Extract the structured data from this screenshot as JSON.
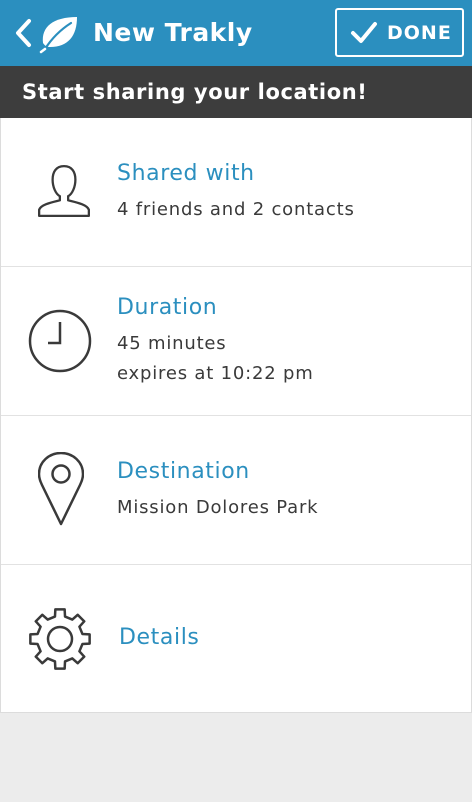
{
  "header": {
    "title": "New Trakly",
    "done_label": "DONE",
    "back_icon": "chevron-left-icon",
    "logo_icon": "leaf-icon",
    "check_icon": "checkmark-icon"
  },
  "banner": {
    "text": "Start sharing your location!"
  },
  "rows": [
    {
      "icon": "person-icon",
      "title": "Shared with",
      "subtitle": "4 friends and 2 contacts"
    },
    {
      "icon": "clock-icon",
      "title": "Duration",
      "subtitle": "45 minutes",
      "subtitle2": "expires at 10:22 pm"
    },
    {
      "icon": "location-pin-icon",
      "title": "Destination",
      "subtitle": "Mission Dolores Park"
    },
    {
      "icon": "gear-icon",
      "title": "Details"
    }
  ],
  "colors": {
    "header_blue": "#2b8fbf",
    "banner_dark": "#3d3d3d",
    "title_blue": "#2b8fbf",
    "background": "#ececec"
  }
}
